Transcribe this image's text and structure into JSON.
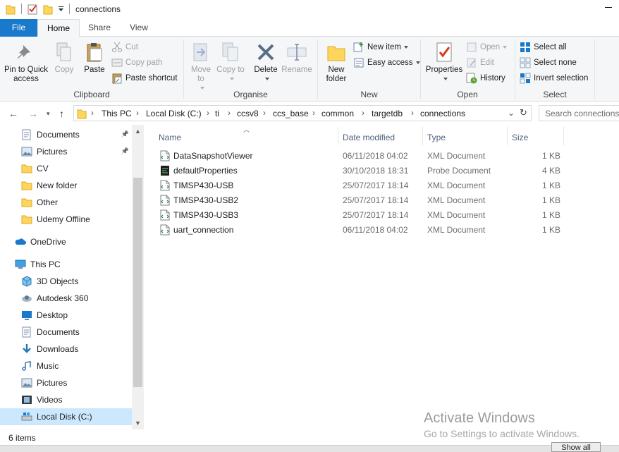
{
  "window": {
    "title": "connections"
  },
  "ribbon_tabs": {
    "file": "File",
    "home": "Home",
    "share": "Share",
    "view": "View"
  },
  "clipboard": {
    "pin_label": "Pin to Quick access",
    "copy_label": "Copy",
    "paste_label": "Paste",
    "cut_label": "Cut",
    "copy_path_label": "Copy path",
    "paste_shortcut_label": "Paste shortcut",
    "group_label": "Clipboard"
  },
  "organise": {
    "move_to_label": "Move to",
    "copy_to_label": "Copy to",
    "delete_label": "Delete",
    "rename_label": "Rename",
    "group_label": "Organise"
  },
  "new_group": {
    "new_folder_label": "New folder",
    "new_item_label": "New item",
    "easy_access_label": "Easy access",
    "group_label": "New"
  },
  "open_group": {
    "properties_label": "Properties",
    "open_label": "Open",
    "edit_label": "Edit",
    "history_label": "History",
    "group_label": "Open"
  },
  "select_group": {
    "select_all_label": "Select all",
    "select_none_label": "Select none",
    "invert_label": "Invert selection",
    "group_label": "Select"
  },
  "address": {
    "crumbs": [
      "This PC",
      "Local Disk (C:)",
      "ti",
      "ccsv8",
      "ccs_base",
      "common",
      "targetdb",
      "connections"
    ]
  },
  "search": {
    "placeholder": "Search connections"
  },
  "nav": {
    "items": [
      {
        "label": "Documents",
        "icon": "documents-icon",
        "pinned": true
      },
      {
        "label": "Pictures",
        "icon": "pictures-icon",
        "pinned": true
      },
      {
        "label": "CV",
        "icon": "folder-icon"
      },
      {
        "label": "New folder",
        "icon": "folder-icon"
      },
      {
        "label": "Other",
        "icon": "folder-icon"
      },
      {
        "label": "Udemy Offline",
        "icon": "folder-icon"
      },
      {
        "label": "OneDrive",
        "icon": "onedrive-icon"
      },
      {
        "label": "This PC",
        "icon": "this-pc-icon"
      },
      {
        "label": "3D Objects",
        "icon": "3d-objects-icon"
      },
      {
        "label": "Autodesk 360",
        "icon": "autodesk-icon"
      },
      {
        "label": "Desktop",
        "icon": "desktop-icon"
      },
      {
        "label": "Documents",
        "icon": "documents-icon"
      },
      {
        "label": "Downloads",
        "icon": "downloads-icon"
      },
      {
        "label": "Music",
        "icon": "music-icon"
      },
      {
        "label": "Pictures",
        "icon": "pictures-icon"
      },
      {
        "label": "Videos",
        "icon": "videos-icon"
      },
      {
        "label": "Local Disk (C:)",
        "icon": "local-disk-icon",
        "selected": true
      }
    ]
  },
  "columns": {
    "name": "Name",
    "date": "Date modified",
    "type": "Type",
    "size": "Size"
  },
  "files": [
    {
      "name": "DataSnapshotViewer",
      "date": "06/11/2018 04:02",
      "type": "XML Document",
      "size": "1 KB",
      "icon": "xml-file-icon"
    },
    {
      "name": "defaultProperties",
      "date": "30/10/2018 18:31",
      "type": "Probe Document",
      "size": "4 KB",
      "icon": "probe-file-icon"
    },
    {
      "name": "TIMSP430-USB",
      "date": "25/07/2017 18:14",
      "type": "XML Document",
      "size": "1 KB",
      "icon": "xml-file-icon"
    },
    {
      "name": "TIMSP430-USB2",
      "date": "25/07/2017 18:14",
      "type": "XML Document",
      "size": "1 KB",
      "icon": "xml-file-icon"
    },
    {
      "name": "TIMSP430-USB3",
      "date": "25/07/2017 18:14",
      "type": "XML Document",
      "size": "1 KB",
      "icon": "xml-file-icon"
    },
    {
      "name": "uart_connection",
      "date": "06/11/2018 04:02",
      "type": "XML Document",
      "size": "1 KB",
      "icon": "xml-file-icon"
    }
  ],
  "status": {
    "item_count": "6 items"
  },
  "watermark": {
    "line1": "Activate Windows",
    "line2": "Go to Settings to activate Windows."
  },
  "taskbar": {
    "show_all": "Show all"
  },
  "colors": {
    "accent": "#1979ca",
    "selection": "#cce8ff",
    "folder": "#ffd65c"
  }
}
